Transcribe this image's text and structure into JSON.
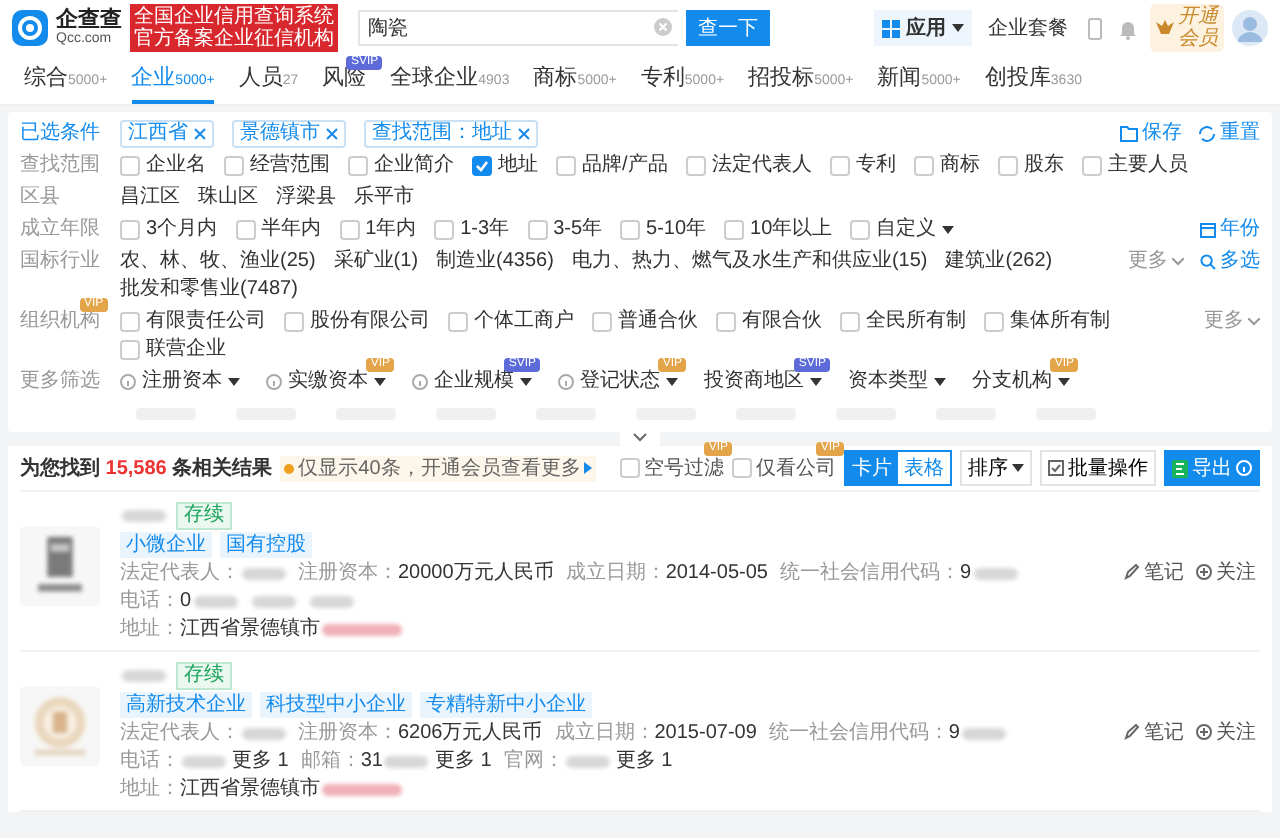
{
  "header": {
    "logo_text": "企查查",
    "logo_domain": "Qcc.com",
    "badge_lines": [
      "全国企业信用查询系统",
      "官方备案企业征信机构"
    ],
    "search": {
      "value": "陶瓷"
    },
    "search_button": "查一下",
    "apps_label": "应用",
    "plan_link": "企业套餐",
    "vip_lines": [
      "开通",
      "会员"
    ]
  },
  "tabs": [
    {
      "label": "综合",
      "count": "5000+",
      "selected": false
    },
    {
      "label": "企业",
      "count": "5000+",
      "selected": true
    },
    {
      "label": "人员",
      "count": "27",
      "selected": false
    },
    {
      "label": "风险",
      "badge": "SVIP",
      "selected": false
    },
    {
      "label": "全球企业",
      "count": "4903",
      "selected": false
    },
    {
      "label": "商标",
      "count": "5000+",
      "selected": false
    },
    {
      "label": "专利",
      "count": "5000+",
      "selected": false
    },
    {
      "label": "招投标",
      "count": "5000+",
      "selected": false
    },
    {
      "label": "新闻",
      "count": "5000+",
      "selected": false
    },
    {
      "label": "创投库",
      "count": "3630",
      "selected": false
    }
  ],
  "filters": {
    "selected": {
      "label": "已选条件",
      "tags": [
        "江西省",
        "景德镇市",
        "查找范围：地址"
      ],
      "save": "保存",
      "reset": "重置"
    },
    "rows": [
      {
        "kind": "checks",
        "label": "查找范围",
        "options": [
          {
            "text": "企业名",
            "checked": false
          },
          {
            "text": "经营范围",
            "checked": false
          },
          {
            "text": "企业简介",
            "checked": false
          },
          {
            "text": "地址",
            "checked": true
          },
          {
            "text": "品牌/产品",
            "checked": false
          },
          {
            "text": "法定代表人",
            "checked": false
          },
          {
            "text": "专利",
            "checked": false
          },
          {
            "text": "商标",
            "checked": false
          },
          {
            "text": "股东",
            "checked": false
          },
          {
            "text": "主要人员",
            "checked": false
          }
        ]
      },
      {
        "kind": "links",
        "label": "区县",
        "options": [
          {
            "text": "昌江区"
          },
          {
            "text": "珠山区"
          },
          {
            "text": "浮梁县"
          },
          {
            "text": "乐平市"
          }
        ]
      },
      {
        "kind": "checks",
        "label": "成立年限",
        "options": [
          {
            "text": "3个月内",
            "checked": false
          },
          {
            "text": "半年内",
            "checked": false
          },
          {
            "text": "1年内",
            "checked": false
          },
          {
            "text": "1-3年",
            "checked": false
          },
          {
            "text": "3-5年",
            "checked": false
          },
          {
            "text": "5-10年",
            "checked": false
          },
          {
            "text": "10年以上",
            "checked": false
          },
          {
            "text": "自定义",
            "checked": false,
            "dropdown": true
          }
        ],
        "side": {
          "kind": "date",
          "text": "年份"
        }
      },
      {
        "kind": "links",
        "label": "国标行业",
        "options": [
          {
            "text": "农、林、牧、渔业(25)"
          },
          {
            "text": "采矿业(1)"
          },
          {
            "text": "制造业(4356)"
          },
          {
            "text": "电力、热力、燃气及水生产和供应业(15)"
          },
          {
            "text": "建筑业(262)"
          },
          {
            "text": "批发和零售业(7487)"
          }
        ],
        "more": "更多",
        "side": {
          "kind": "multi",
          "text": "多选"
        }
      },
      {
        "kind": "checks",
        "label": "组织机构",
        "badge": "VIP",
        "options": [
          {
            "text": "有限责任公司",
            "checked": false
          },
          {
            "text": "股份有限公司",
            "checked": false
          },
          {
            "text": "个体工商户",
            "checked": false
          },
          {
            "text": "普通合伙",
            "checked": false
          },
          {
            "text": "有限合伙",
            "checked": false
          },
          {
            "text": "全民所有制",
            "checked": false
          },
          {
            "text": "集体所有制",
            "checked": false
          },
          {
            "text": "联营企业",
            "checked": false
          }
        ],
        "more": "更多"
      },
      {
        "kind": "dropdowns",
        "label": "更多筛选",
        "options": [
          {
            "text": "注册资本",
            "info": true
          },
          {
            "text": "实缴资本",
            "info": true,
            "badge": "VIP"
          },
          {
            "text": "企业规模",
            "info": true,
            "badge": "SVIP"
          },
          {
            "text": "登记状态",
            "info": true,
            "badge": "VIP"
          },
          {
            "text": "投资商地区",
            "info": false,
            "badge": "SVIP"
          },
          {
            "text": "资本类型",
            "info": false
          },
          {
            "text": "分支机构",
            "info": false,
            "badge": "VIP"
          }
        ]
      }
    ]
  },
  "results": {
    "prefix": "为您找到",
    "count": "15,586",
    "suffix": "条相关结果",
    "notice": "仅显示40条，开通会员查看更多",
    "toggles": [
      {
        "text": "空号过滤",
        "checked": false,
        "badge": "VIP"
      },
      {
        "text": "仅看公司",
        "checked": false,
        "badge": "VIP"
      }
    ],
    "views": [
      {
        "text": "卡片",
        "selected": true
      },
      {
        "text": "表格",
        "selected": false
      }
    ],
    "sort": "排序",
    "batch": "批量操作",
    "export": "导出"
  },
  "companies": [
    {
      "status": "存续",
      "tags": [
        "小微企业",
        "国有控股"
      ],
      "fields": [
        {
          "label": "法定代表人：",
          "blur": true
        },
        {
          "label": "注册资本：",
          "value": "20000万元人民币"
        },
        {
          "label": "成立日期：",
          "value": "2014-05-05"
        },
        {
          "label": "统一社会信用代码：",
          "value": "9",
          "blur": true
        }
      ],
      "contacts": [
        {
          "label": "电话：",
          "value": "0",
          "blur": true
        },
        {
          "blur": true
        },
        {
          "blur": true
        }
      ],
      "address": {
        "label": "地址：",
        "value": "江西省景德镇市"
      },
      "note": "笔记",
      "follow": "关注"
    },
    {
      "status": "存续",
      "tags": [
        "高新技术企业",
        "科技型中小企业",
        "专精特新中小企业"
      ],
      "fields": [
        {
          "label": "法定代表人：",
          "blur": true
        },
        {
          "label": "注册资本：",
          "value": "6206万元人民币"
        },
        {
          "label": "成立日期：",
          "value": "2015-07-09"
        },
        {
          "label": "统一社会信用代码：",
          "value": "9",
          "blur": true
        }
      ],
      "contacts": [
        {
          "label": "电话：",
          "blur": true,
          "more": "更多 1"
        },
        {
          "label": "邮箱：",
          "value": "31",
          "blur": true,
          "more": "更多 1"
        },
        {
          "label": "官网：",
          "blur": true,
          "more": "更多 1"
        }
      ],
      "address": {
        "label": "地址：",
        "value": "江西省景德镇市"
      },
      "note": "笔记",
      "follow": "关注"
    }
  ]
}
